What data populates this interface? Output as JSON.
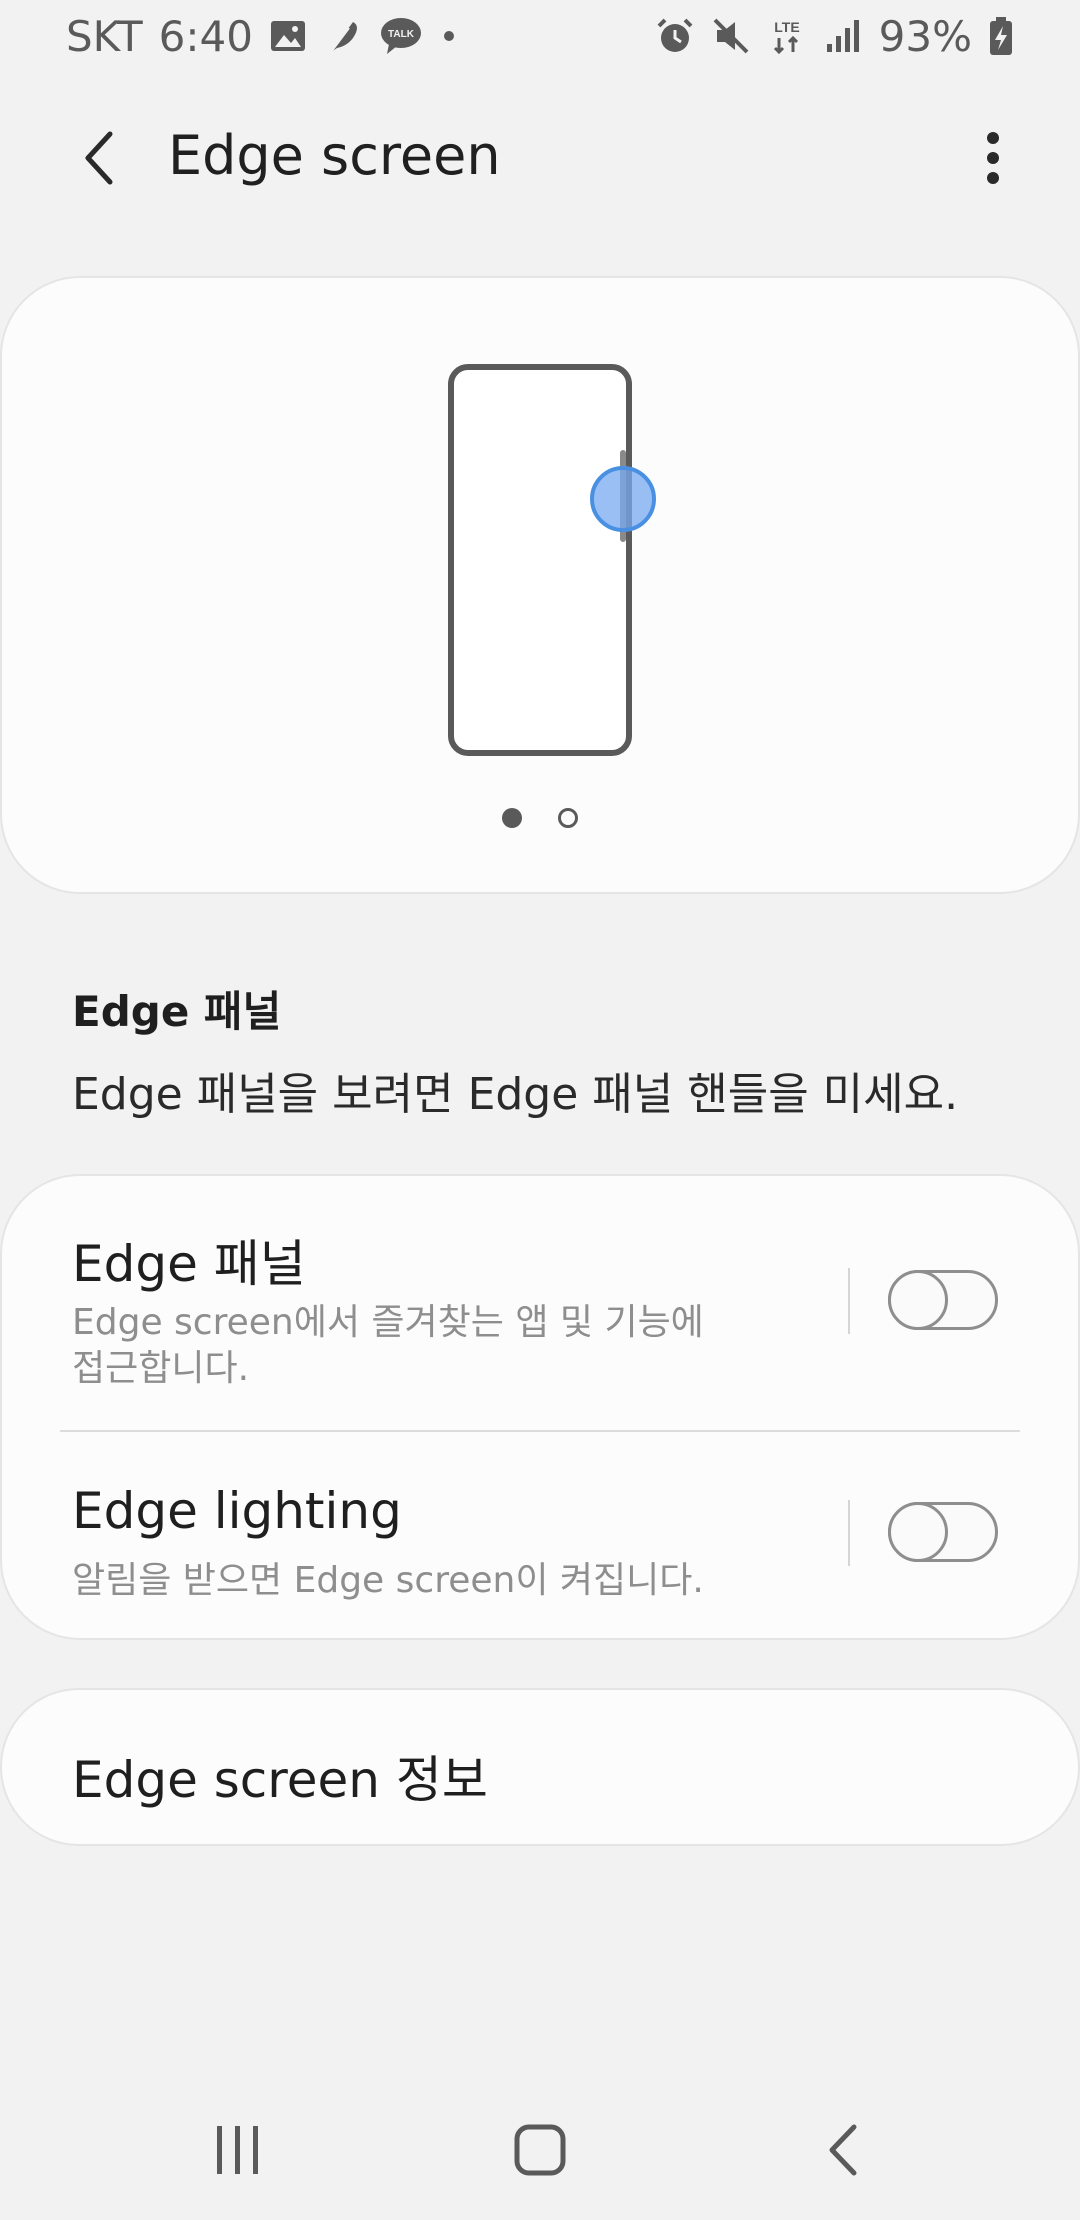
{
  "status_bar": {
    "carrier": "SKT",
    "time": "6:40",
    "battery": "93%",
    "left_icons": [
      "image-icon",
      "feather-icon",
      "kakaotalk-icon",
      "dot-icon"
    ],
    "right_icons": [
      "alarm-icon",
      "mute-icon",
      "lte-icon",
      "signal-icon",
      "battery-icon"
    ],
    "talk_label": "TALK",
    "lte_label": "LTE"
  },
  "appbar": {
    "title": "Edge screen"
  },
  "preview": {
    "page_count": 2,
    "active_page": 1
  },
  "edge_panel_section": {
    "title": "Edge 패널",
    "description": "Edge 패널을 보려면 Edge 패널 핸들을 미세요."
  },
  "settings": {
    "items": [
      {
        "title": "Edge 패널",
        "subtitle_line1": "Edge screen에서 즐겨찾는 앱 및 기능에",
        "subtitle_line2": "접근합니다.",
        "enabled": false
      },
      {
        "title": "Edge lighting",
        "subtitle_line1": "알림을 받으면 Edge screen이 켜집니다.",
        "subtitle_line2": "",
        "enabled": false
      }
    ]
  },
  "about": {
    "label": "Edge screen 정보"
  },
  "colors": {
    "background": "#f2f2f2",
    "card": "#fcfcfc",
    "accent_blue": "#4a90e2",
    "text_primary": "#1f1f1f",
    "text_secondary": "#8e8e8e"
  }
}
